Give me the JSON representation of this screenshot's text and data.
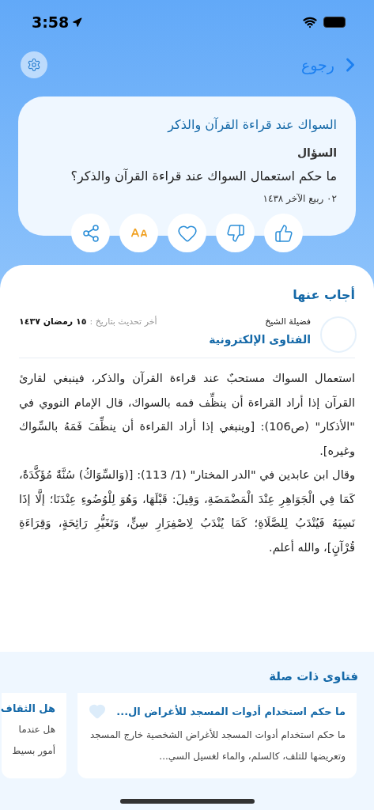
{
  "status_bar": {
    "time": "3:58"
  },
  "nav": {
    "back_label": "رجوع"
  },
  "question_card": {
    "title": "السواك عند قراءة القرآن والذكر",
    "label": "السؤال",
    "question": "ما حكم استعمال السواك عند قراءة القرآن والذكر؟",
    "date": "٠٢ ربيع الآخر ١٤٣٨"
  },
  "actions": [
    {
      "kind": "like"
    },
    {
      "kind": "dislike"
    },
    {
      "kind": "favorite"
    },
    {
      "kind": "font"
    },
    {
      "kind": "share"
    }
  ],
  "answer": {
    "heading": "أجاب عنها",
    "mufti_title": "فضيلة الشيخ",
    "mufti_name": "الفتاوى الإلكترونية",
    "updated_label": "أخر تحديث بتاريخ :",
    "updated_date": "١٥ رمضان ١٤٣٧",
    "paragraphs": [
      "استعمال السواك مستحبٌ عند قراءة القرآن والذكر، فينبغي لقارئ القرآن إذا أراد القراءة أن ينظِّف فمه بالسواك، قال الإمام النووي في \"الأذكار\" (ص106): [وينبغي إذا أراد القراءة أن ينظِّفَ فَمَهُ بالسِّواك وغيره].",
      "وقال ابن عابدين في \"الدر المختار\" (1/ 113): [(وَالسِّوَاكُ) سُنَّةٌ مُؤَكَّدَةٌ، كَمَا فِي الْجَوَاهِرِ عِنْدَ الْمَضْمَضَةِ، وَقِيلَ: قَبْلَهَا، وَهُوَ لِلْوُضُوءِ عِنْدَنَا؛ إلَّا إذَا نَسِيَهُ فَيُنْدَبُ لِلصَّلَاةِ؛ كَمَا يُنْدَبُ لِاصْفِرَارِ سِنٍّ، وَتَغَيُّرِ رَائِحَةٍ، وَقِرَاءَةِ قُرْآنٍ]، والله أعلم."
    ]
  },
  "related": {
    "heading": "فتاوى ذات صلة",
    "items": [
      {
        "title": "ما حكم استخدام أدوات المسجد للأغراض ال...",
        "snippet": "ما حكم استخدام أدوات المسجد للأغراض الشخصية خارج المسجد وتعريضها للتلف، كالسلم، والماء لغسيل السي..."
      },
      {
        "title": "هل الثقاف",
        "snippet": "هل عندما أمور بسيط"
      }
    ]
  }
}
